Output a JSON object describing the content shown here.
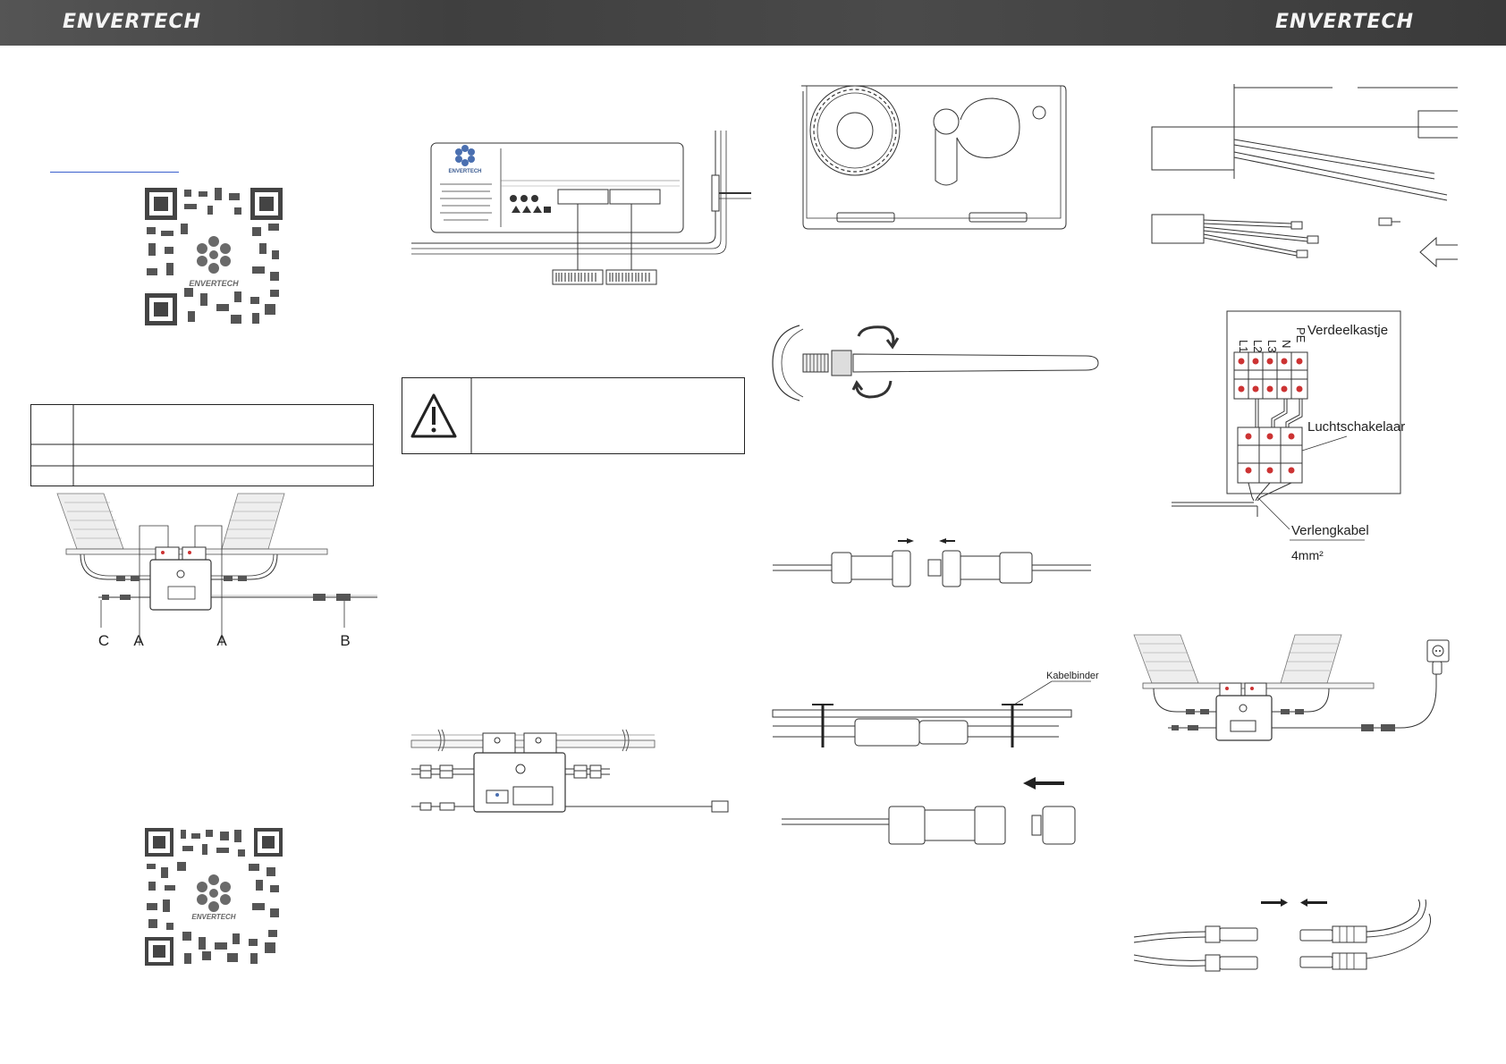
{
  "header": {
    "brand_left": "ENVERTECH",
    "brand_right": "ENVERTECH"
  },
  "qr_top": {
    "logo_text": "ENVERTECH"
  },
  "qr_bottom": {
    "logo_text": "ENVERTECH"
  },
  "device_label": {
    "logo_text": "ENVERTECH"
  },
  "wiring_diagram": {
    "label_c": "C",
    "label_a1": "A",
    "label_a2": "A",
    "label_b": "B"
  },
  "cable_tie": {
    "label": "Kabelbinder"
  },
  "distribution_box": {
    "title": "Verdeelkastje",
    "terminals": [
      "L1",
      "L2",
      "L3",
      "N",
      "PE"
    ],
    "breaker_label": "Luchtschakelaar",
    "cable_label": "Verlengkabel",
    "cable_spec": "4mm²"
  }
}
